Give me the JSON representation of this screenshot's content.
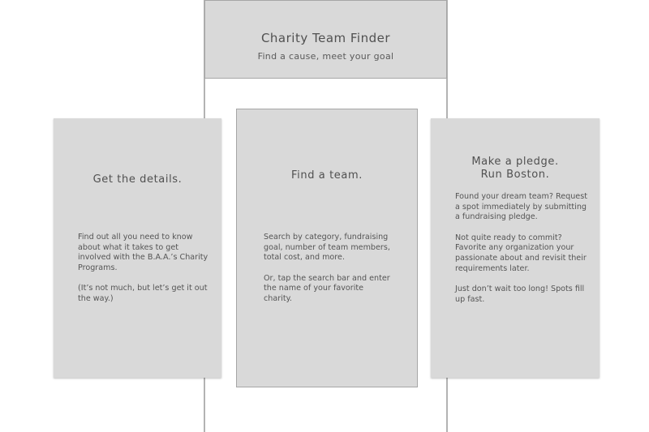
{
  "header": {
    "title": "Charity Team Finder",
    "subtitle": "Find a cause, meet your goal"
  },
  "cards": [
    {
      "title": "Get the details.",
      "paragraphs": [
        "Find out all you need to know about what it takes to get involved with the B.A.A.’s Charity Programs.",
        "(It’s not much, but let’s get it out the way.)"
      ]
    },
    {
      "title": "Find a team.",
      "paragraphs": [
        "Search by category, fundraising goal, number of team members, total cost, and more.",
        "Or, tap the search bar and enter the name of your favorite charity."
      ]
    },
    {
      "title": "Make a pledge.\nRun Boston.",
      "paragraphs": [
        "Found your dream team? Request a spot immediately by submitting a fundraising pledge.",
        "Not quite ready to commit? Favorite any organization your passionate about and revisit their requirements later.",
        "Just don’t wait too long! Spots fill up fast."
      ]
    }
  ]
}
